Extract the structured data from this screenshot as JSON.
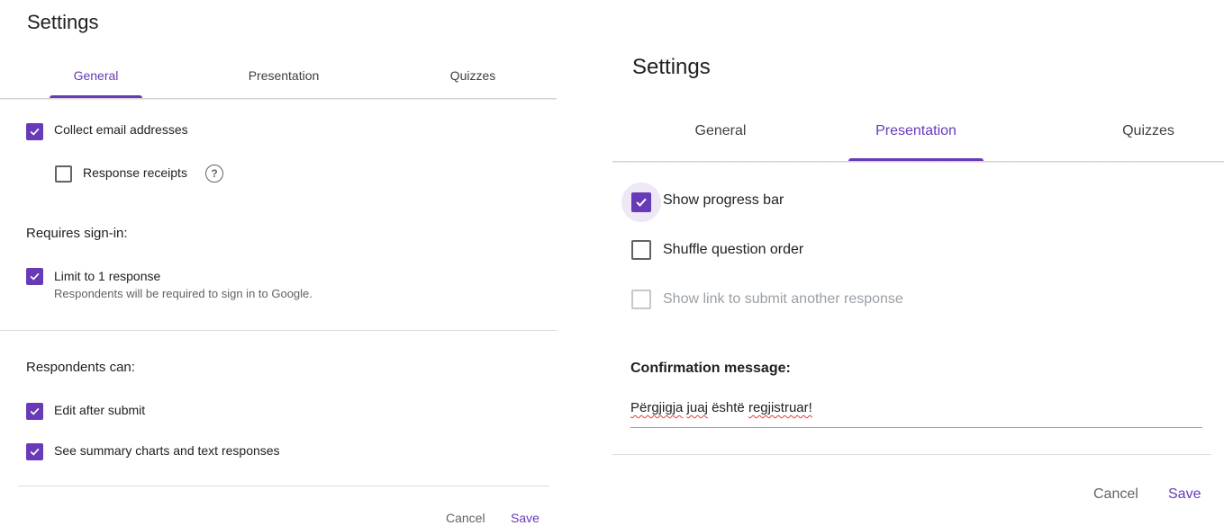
{
  "left": {
    "title": "Settings",
    "tabs": [
      {
        "label": "General",
        "active": true
      },
      {
        "label": "Presentation",
        "active": false
      },
      {
        "label": "Quizzes",
        "active": false
      }
    ],
    "collect_email": {
      "label": "Collect email addresses",
      "checked": true
    },
    "response_receipts": {
      "label": "Response receipts",
      "checked": false,
      "help_glyph": "?"
    },
    "requires_signin": "Requires sign-in:",
    "limit_response": {
      "label": "Limit to 1 response",
      "sublabel": "Respondents will be required to sign in to Google.",
      "checked": true
    },
    "respondents_can": "Respondents can:",
    "edit_after_submit": {
      "label": "Edit after submit",
      "checked": true
    },
    "see_summary": {
      "label": "See summary charts and text responses",
      "checked": true
    },
    "cancel": "Cancel",
    "save": "Save"
  },
  "right": {
    "title": "Settings",
    "tabs": [
      {
        "label": "General",
        "active": false
      },
      {
        "label": "Presentation",
        "active": true
      },
      {
        "label": "Quizzes",
        "active": false
      }
    ],
    "show_progress": {
      "label": "Show progress bar",
      "checked": true
    },
    "shuffle": {
      "label": "Shuffle question order",
      "checked": false
    },
    "submit_another": {
      "label": "Show link to submit another response",
      "checked": false,
      "disabled": true
    },
    "confirmation_label": "Confirmation message:",
    "confirmation_words": [
      "Përgjigja",
      "juaj",
      "është",
      "regjistruar!"
    ],
    "cancel": "Cancel",
    "save": "Save"
  },
  "colors": {
    "accent": "#673ab7",
    "halo": "#ede7f6",
    "divider": "#dadce0",
    "muted": "#5f6368"
  },
  "icons": {
    "check": "check-icon",
    "help": "help-circle-icon"
  }
}
